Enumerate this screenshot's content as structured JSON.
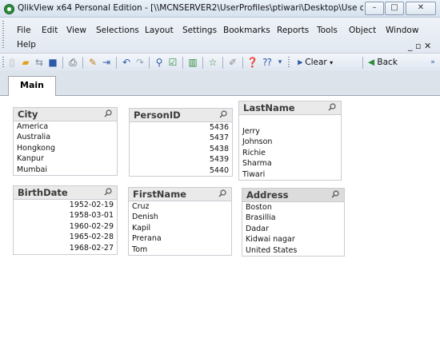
{
  "window": {
    "title": "QlikView x64 Personal Edition - [\\\\MCNSERVER2\\UserProfiles\\ptiwari\\Desktop\\Use of QV...",
    "controls": [
      "–",
      "□",
      "✕"
    ]
  },
  "menu": {
    "items": [
      "File",
      "Edit",
      "View",
      "Selections",
      "Layout",
      "Settings",
      "Bookmarks",
      "Reports",
      "Tools",
      "Object",
      "Window",
      "Help"
    ],
    "mdi_controls": "_ ▫ ✕"
  },
  "toolbar": {
    "icons": [
      "new-doc-icon",
      "open-folder-icon",
      "reload-icon",
      "save-icon",
      "print-icon",
      "edit-script-icon",
      "reload-data-icon",
      "undo-icon",
      "redo-icon",
      "search-icon",
      "select-icon",
      "chart-icon",
      "favorite-icon",
      "edit-icon",
      "help-icon",
      "context-help-icon"
    ],
    "clear_label": "Clear",
    "back_label": "Back"
  },
  "tabs": [
    {
      "label": "Main"
    }
  ],
  "listboxes": {
    "city": {
      "title": "City",
      "values": [
        "America",
        "Australia",
        "Hongkong",
        "Kanpur",
        "Mumbai"
      ]
    },
    "personid": {
      "title": "PersonID",
      "values": [
        "5436",
        "5437",
        "5438",
        "5439",
        "5440"
      ]
    },
    "lastname": {
      "title": "LastName",
      "values": [
        "Jerry",
        "Johnson",
        "Richie",
        "Sharma",
        "Tiwari"
      ]
    },
    "birthdate": {
      "title": "BirthDate",
      "values": [
        "1952-02-19",
        "1958-03-01",
        "1960-02-29",
        "1965-02-28",
        "1968-02-27"
      ]
    },
    "firstname": {
      "title": "FirstName",
      "values": [
        "Cruz",
        "Denish",
        "Kapil",
        "Prerana",
        "Tom"
      ]
    },
    "address": {
      "title": "Address",
      "values": [
        "Boston",
        "Brasillia",
        "Dadar",
        "Kidwai nagar",
        "United States"
      ]
    }
  }
}
